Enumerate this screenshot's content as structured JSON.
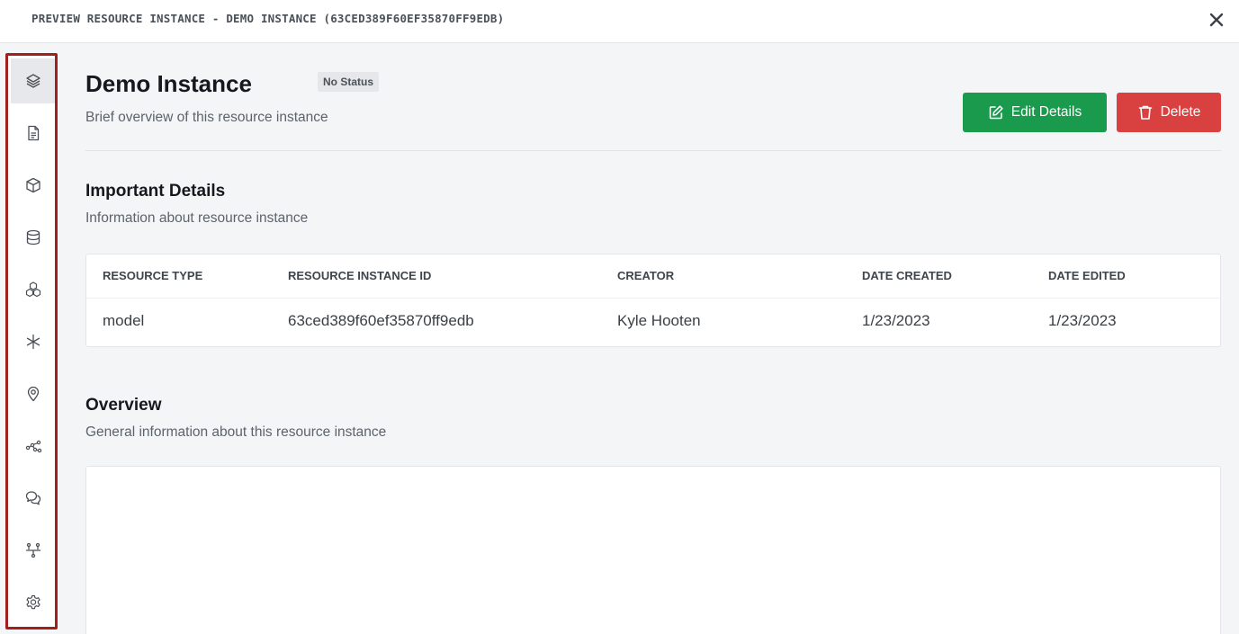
{
  "header": {
    "title": "PREVIEW RESOURCE INSTANCE - DEMO INSTANCE (63CED389F60EF35870FF9EDB)"
  },
  "sidebar": {
    "items": [
      {
        "icon": "layers-icon",
        "active": true
      },
      {
        "icon": "document-icon",
        "active": false
      },
      {
        "icon": "cube-icon",
        "active": false
      },
      {
        "icon": "database-icon",
        "active": false
      },
      {
        "icon": "cubes-icon",
        "active": false
      },
      {
        "icon": "asterisk-icon",
        "active": false
      },
      {
        "icon": "location-pin-icon",
        "active": false
      },
      {
        "icon": "network-icon",
        "active": false
      },
      {
        "icon": "chat-bubbles-icon",
        "active": false
      },
      {
        "icon": "hierarchy-icon",
        "active": false
      },
      {
        "icon": "gear-icon",
        "active": false
      }
    ]
  },
  "page": {
    "title": "Demo Instance",
    "status": "No Status",
    "subtitle": "Brief overview of this resource instance"
  },
  "actions": {
    "edit_label": "Edit Details",
    "delete_label": "Delete"
  },
  "details": {
    "title": "Important Details",
    "description": "Information about resource instance",
    "columns": [
      "RESOURCE TYPE",
      "RESOURCE INSTANCE ID",
      "CREATOR",
      "DATE CREATED",
      "DATE EDITED"
    ],
    "values": [
      "model",
      "63ced389f60ef35870ff9edb",
      "Kyle Hooten",
      "1/23/2023",
      "1/23/2023"
    ]
  },
  "overview": {
    "title": "Overview",
    "description": "General information about this resource instance"
  },
  "colors": {
    "edit_button": "#1a9a4d",
    "delete_button": "#d8413f",
    "sidebar_highlight": "#a11f1f"
  }
}
